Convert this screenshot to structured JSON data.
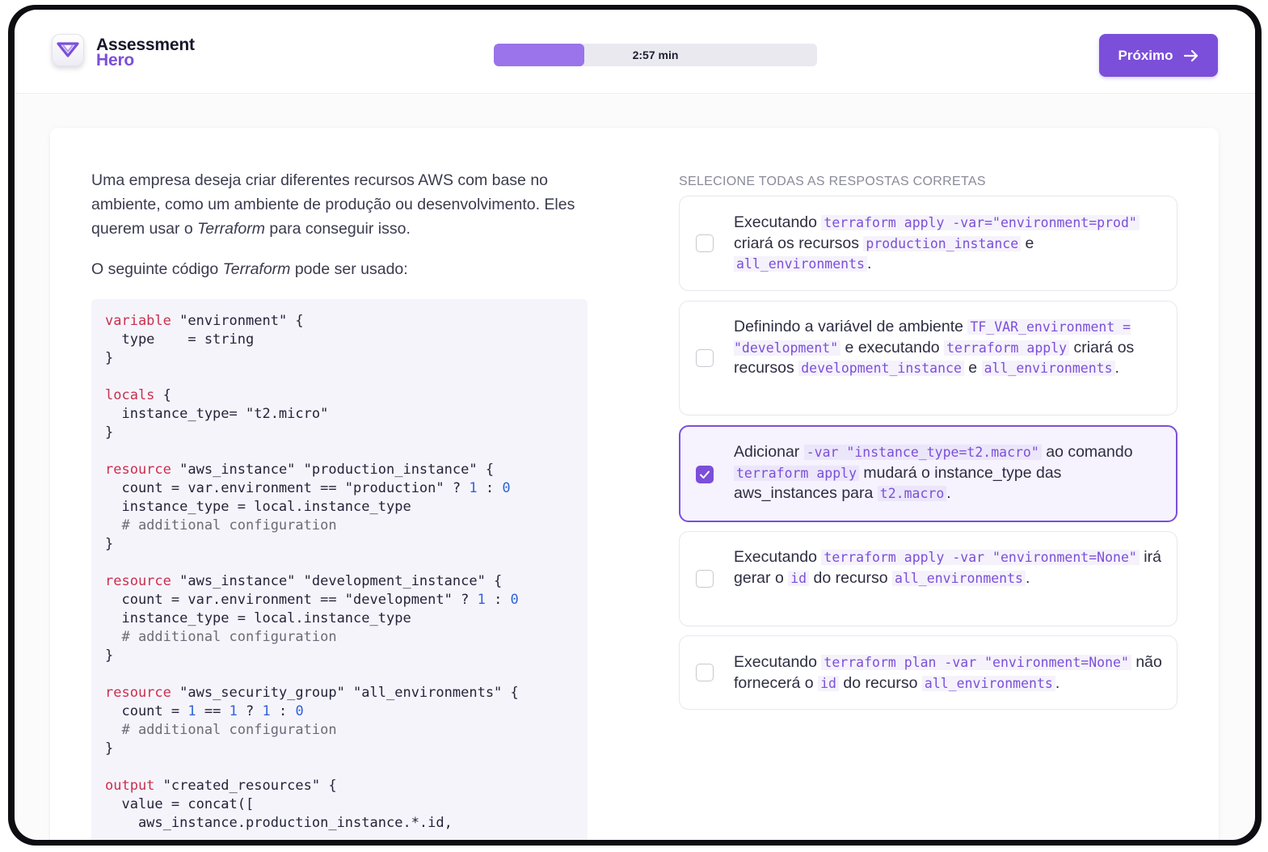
{
  "brand": {
    "line1": "Assessment",
    "line2": "Hero"
  },
  "timer": {
    "label": "2:57 min",
    "progress": 0.28
  },
  "header": {
    "next_label": "Próximo"
  },
  "question": {
    "p1_a": "Uma empresa deseja criar diferentes recursos AWS com base no ambiente, como um ambiente de produção ou desenvolvimento. Eles querem usar o ",
    "p1_em": "Terraform",
    "p1_b": " para conseguir isso.",
    "p2_a": "O seguinte código ",
    "p2_em": "Terraform",
    "p2_b": " pode ser usado:"
  },
  "code": {
    "l1_kw": "variable",
    "l1_rest": " \"environment\" {",
    "l2": "  type    = string",
    "l3": "}",
    "l5_kw": "locals",
    "l5_rest": " {",
    "l6": "  instance_type= \"t2.micro\"",
    "l7": "}",
    "l9_kw": "resource",
    "l9_rest": " \"aws_instance\" \"production_instance\" {",
    "l10_a": "  count = var.environment == \"production\" ? ",
    "l10_n1": "1",
    "l10_b": " : ",
    "l10_n2": "0",
    "l11": "  instance_type = local.instance_type",
    "l12": "  # additional configuration",
    "l13": "}",
    "l15_kw": "resource",
    "l15_rest": " \"aws_instance\" \"development_instance\" {",
    "l16_a": "  count = var.environment == \"development\" ? ",
    "l16_n1": "1",
    "l16_b": " : ",
    "l16_n2": "0",
    "l17": "  instance_type = local.instance_type",
    "l18": "  # additional configuration",
    "l19": "}",
    "l21_kw": "resource",
    "l21_rest": " \"aws_security_group\" \"all_environments\" {",
    "l22_a": "  count = ",
    "l22_n1": "1",
    "l22_b": " == ",
    "l22_n2": "1",
    "l22_c": " ? ",
    "l22_n3": "1",
    "l22_d": " : ",
    "l22_n4": "0",
    "l23": "  # additional configuration",
    "l24": "}",
    "l26_kw": "output",
    "l26_rest": " \"created_resources\" {",
    "l27": "  value = concat([",
    "l28": "    aws_instance.production_instance.*.id,"
  },
  "answers": {
    "instructions": "SELECIONE TODAS AS RESPOSTAS CORRETAS",
    "opt1": {
      "t1": "Executando ",
      "c1": "terraform apply -var=\"environment=prod\"",
      "t2": " criará os recursos ",
      "c2": "production_instance",
      "t3": " e ",
      "c3": "all_environments",
      "t4": ".",
      "checked": false
    },
    "opt2": {
      "t1": "Definindo a variável de ambiente ",
      "c1": "TF_VAR_environment = \"development\"",
      "t2": " e executando ",
      "c2": "terraform apply",
      "t3": " criará os recursos ",
      "c3": "development_instance",
      "t4": " e ",
      "c4": "all_environments",
      "t5": ".",
      "checked": false
    },
    "opt3": {
      "t1": "Adicionar ",
      "c1": "-var \"instance_type=t2.macro\"",
      "t2": " ao comando ",
      "c2": "terraform apply",
      "t3": " mudará o instance_type das aws_instances para ",
      "c3": "t2.macro",
      "t4": ".",
      "checked": true
    },
    "opt4": {
      "t1": "Executando ",
      "c1": "terraform apply -var \"environment=None\"",
      "t2": " irá gerar o ",
      "c2": "id",
      "t3": " do recurso ",
      "c3": "all_environments",
      "t4": ".",
      "checked": false
    },
    "opt5": {
      "t1": "Executando ",
      "c1": "terraform plan -var \"environment=None\"",
      "t2": " não fornecerá o ",
      "c2": "id",
      "t3": " do recurso ",
      "c3": "all_environments",
      "t4": ".",
      "checked": false
    }
  },
  "colors": {
    "accent": "#7b4fd9",
    "progress_fill": "#9b73ea",
    "keyword": "#c8304e",
    "number": "#2f64d8"
  }
}
